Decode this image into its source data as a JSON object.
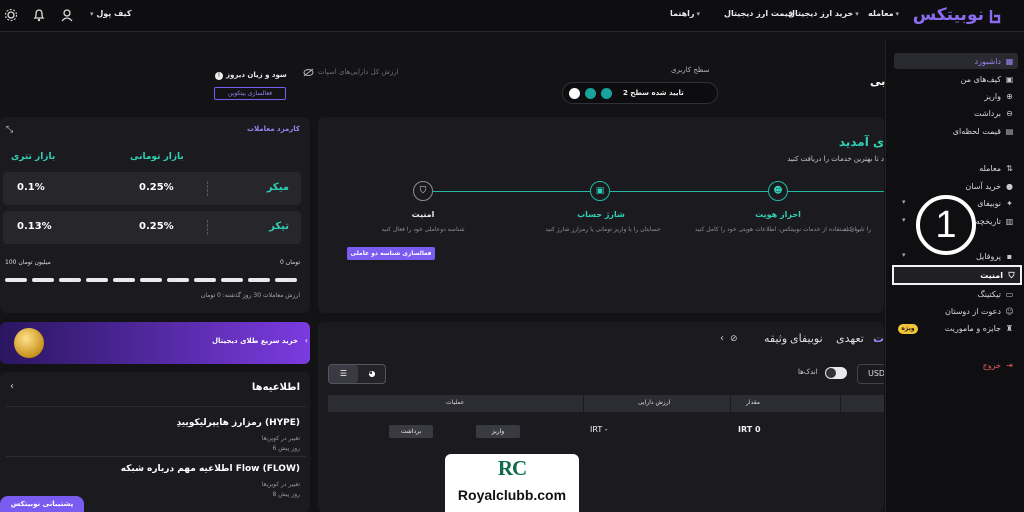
{
  "topbar": {
    "logo": "نوبیتکس",
    "menu": [
      {
        "label": "معامله"
      },
      {
        "label": "خرید ارز دیجیتال"
      },
      {
        "label": "قیمت ارز دیجیتال"
      },
      {
        "label": "راهنما"
      }
    ],
    "wallet_label": "کیف پول"
  },
  "sidebar": {
    "items": [
      {
        "label": "داشبورد",
        "icon": "grid-icon"
      },
      {
        "label": "کیف‌های من",
        "icon": "wallet-icon"
      },
      {
        "label": "واریز",
        "icon": "deposit-icon"
      },
      {
        "label": "برداشت",
        "icon": "withdraw-icon"
      },
      {
        "label": "قیمت لحظه‌ای",
        "icon": "chart-icon"
      },
      {
        "label": "معامله",
        "icon": "trade-icon"
      },
      {
        "label": "خرید آسان",
        "icon": "easy-buy-icon"
      },
      {
        "label": "نوبیفای",
        "icon": "sparkle-icon"
      },
      {
        "label": "تاریخچه",
        "icon": "calendar-icon"
      },
      {
        "label": "پروفایل",
        "icon": "profile-icon"
      },
      {
        "label": "امنیت",
        "icon": "shield-icon"
      },
      {
        "label": "تیکتینگ",
        "icon": "ticket-icon"
      },
      {
        "label": "دعوت از دوستان",
        "icon": "invite-icon"
      },
      {
        "label": "جایزه و ماموریت",
        "icon": "trophy-icon"
      },
      {
        "label": "خروج",
        "icon": "logout-icon"
      }
    ],
    "prize_badge": "ویژه",
    "annotation_number": "1"
  },
  "header": {
    "level_title": "سطح کاربری",
    "level_status": "تایید شده سطح 2",
    "asset_label": "ارزش کل دارایی‌های اسپات",
    "pnl_title": "سود و زیان دیروز",
    "pnl_button": "فعالسازی بیتکوین",
    "name_fragment": "بی"
  },
  "welcome": {
    "title": "ی آمدید",
    "subtitle": "د تا بهترین خدمات را دریافت کنید",
    "left_desc": "را تایید کنید",
    "steps": [
      {
        "title": "احراز هویت",
        "desc": "برای استفاده از خدمات نوبیتکس، اطلاعات هویتی خود را کامل کنید"
      },
      {
        "title": "شارژ حساب",
        "desc": "حسابتان را با واریز تومانی یا رمزارز شارژ کنید"
      },
      {
        "title": "امنیت",
        "desc": "شناسه دوعاملی خود را فعال کنید",
        "button": "فعالسازی شناسه دو عاملی"
      }
    ]
  },
  "fees": {
    "title": "کارمزد معاملات",
    "col_toman": "بازار تومانی",
    "col_tether": "بازار تتری",
    "rows": [
      {
        "label": "میکر",
        "toman": "0.25%",
        "tether": "0.1%"
      },
      {
        "label": "تیکر",
        "toman": "0.25%",
        "tether": "0.13%"
      }
    ],
    "scale_min": "0 تومان",
    "scale_max": "100 میلیون تومان",
    "volume_text": "ارزش معاملات 30 روز گذشته: 0 تومان"
  },
  "gold": {
    "label": "خرید سریع طلای دیجیتال"
  },
  "news": {
    "title": "اطلاعیه‌ها",
    "items": [
      {
        "title": "رمزارز هایپرلیکوییدِ (HYPE)",
        "sub": "تغییر در کوین‌ها",
        "time": "6 روز پیش"
      },
      {
        "title": "اطلاعیه مهم درباره شبکه Flow (FLOW)",
        "sub": "تغییر در کوین‌ها",
        "time": "8 روز پیش"
      }
    ]
  },
  "assets": {
    "tabs": [
      "ت",
      "تعهدی",
      "نوبیفای",
      "وثیقه"
    ],
    "small_label": "اندک‌ها",
    "currency": "USD",
    "headers": [
      "مقدار",
      "ارزش دارایی",
      "عملیات"
    ],
    "row": {
      "amount": "IRT 0",
      "value": "IRT -",
      "deposit": "واریز",
      "withdraw": "برداشت"
    }
  },
  "support": {
    "label": "پشتیبانی نوبیتکس"
  },
  "watermark": {
    "text": "Royalclubb.com",
    "logo": "RC"
  }
}
